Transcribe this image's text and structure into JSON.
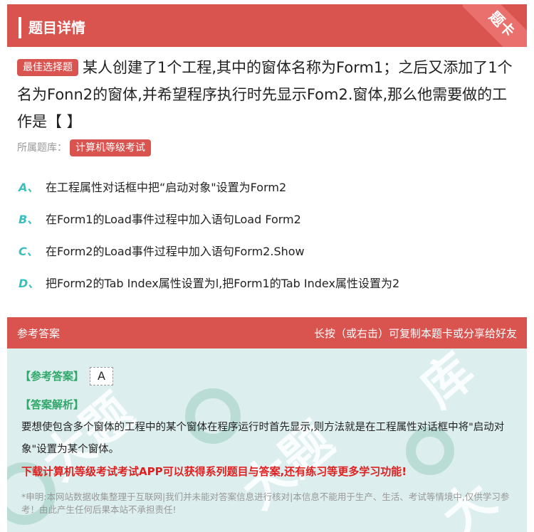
{
  "header": {
    "title": "题目详情",
    "corner": "题卡"
  },
  "question": {
    "badge": "最佳选择题",
    "text": "某人创建了1个工程,其中的窗体名称为Form1；之后又添加了1个名为Fonn2的窗体,并希望程序执行时先显示Fom2.窗体,那么他需要做的工作是【 】"
  },
  "bank": {
    "label": "所属题库：",
    "tag": "计算机等级考试"
  },
  "options": [
    {
      "letter": "A、",
      "text": "在工程属性对话框中把“启动对象\"设置为Form2"
    },
    {
      "letter": "B、",
      "text": "在Form1的Load事件过程中加入语句Load Form2"
    },
    {
      "letter": "C、",
      "text": "在Form2的Load事件过程中加入语句Form2.Show"
    },
    {
      "letter": "D、",
      "text": "把Form2的Tab Index属性设置为l,把Form1的Tab Index属性设置为2"
    }
  ],
  "answer_section": {
    "title": "参考答案",
    "hint": "长按（或右击）可复制本题卡或分享给好友",
    "answer_label": "【参考答案】",
    "answer_value": "A",
    "analysis_label": "【答案解析】",
    "analysis_text": "要想使包含多个窗体的工程中的某个窗体在程序运行时首先显示,则方法就是在工程属性对话框中将\"启动对象\"设置为某个窗体。",
    "promo": "下载计算机等级考试考试APP可以获得系列题目与答案,还有练习等更多学习功能!",
    "disclaimer": "*申明:本网站数据收集整理于互联网|我们并未能对答案信息进行核对|本信息不能用于生产、生活、考试等情境中,仅供学习参考！由此产生任何后果本站不承担责任!"
  },
  "colors": {
    "primary": "#d9534f",
    "accent": "#3dbfbf",
    "answer_bg": "#dceeed"
  }
}
